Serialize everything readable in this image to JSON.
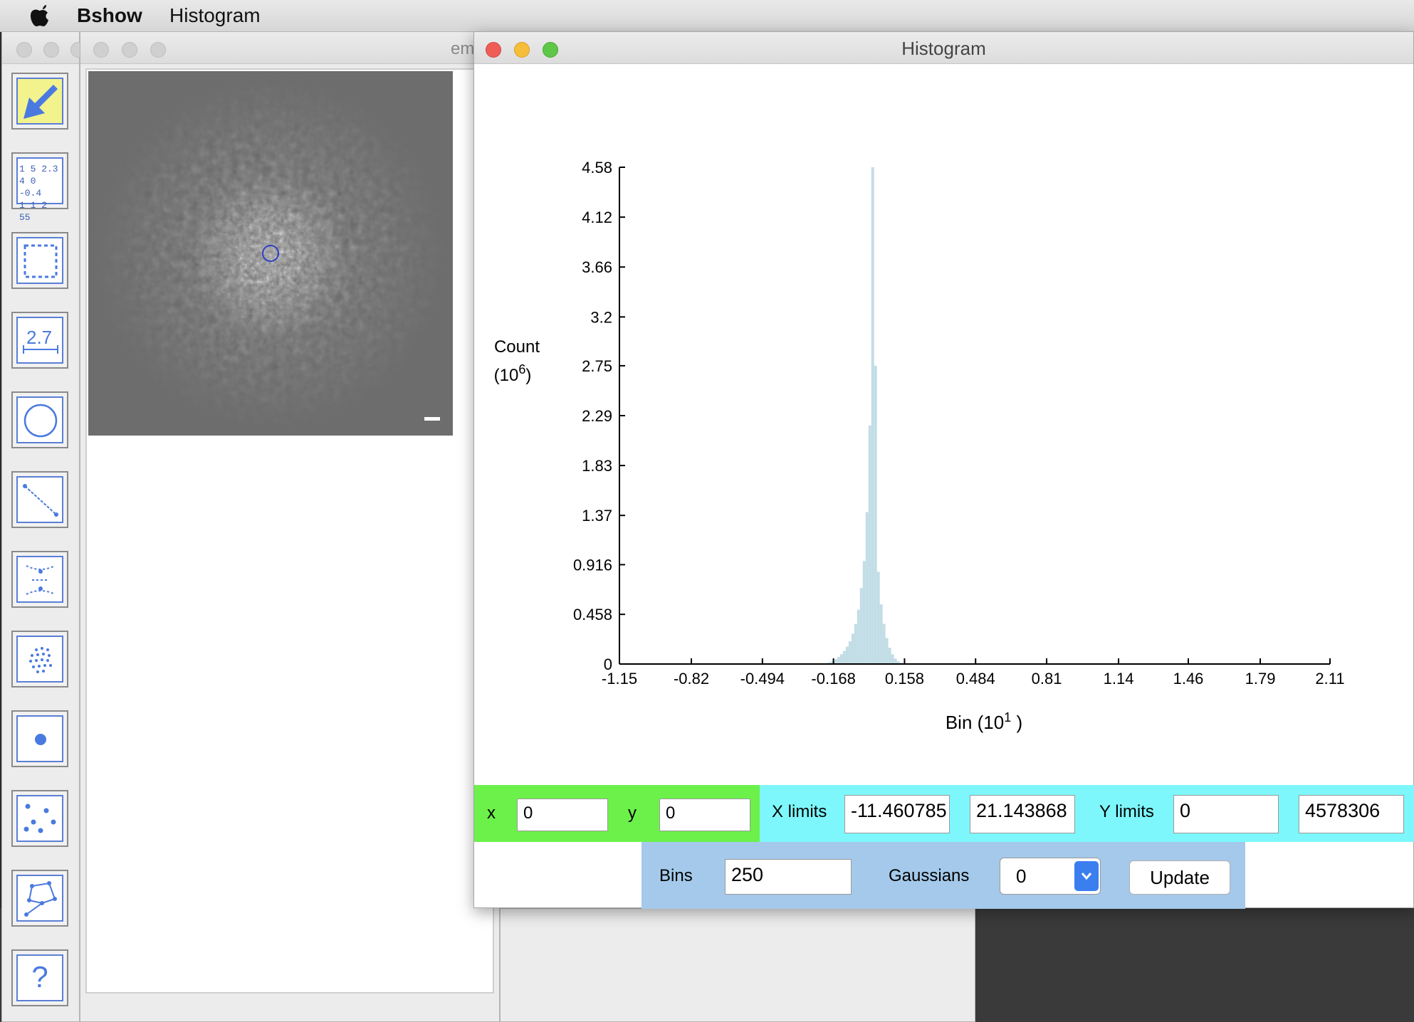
{
  "menubar": {
    "app": "Bshow",
    "menu": "Histogram"
  },
  "image_window": {
    "title_fragment": "em"
  },
  "tools": [
    {
      "name": "pointer-tool",
      "icon": "arrow-pointer-icon",
      "active": true
    },
    {
      "name": "values-tool",
      "icon": "number-grid-icon",
      "lines": [
        "1 5 2.3",
        "4 0 -0.4",
        "1 1 2 55"
      ]
    },
    {
      "name": "box-select-tool",
      "icon": "dashed-box-icon"
    },
    {
      "name": "measure-tool",
      "icon": "ruler-icon",
      "text": "2.7"
    },
    {
      "name": "circle-tool",
      "icon": "circle-icon"
    },
    {
      "name": "line-tool",
      "icon": "line-segment-icon"
    },
    {
      "name": "filament-tool",
      "icon": "filament-icon"
    },
    {
      "name": "lattice-tool",
      "icon": "dot-lattice-icon"
    },
    {
      "name": "point-tool",
      "icon": "dot-icon"
    },
    {
      "name": "points-tool",
      "icon": "scattered-points-icon"
    },
    {
      "name": "polygon-tool",
      "icon": "polygon-icon"
    },
    {
      "name": "help-tool",
      "icon": "question-icon",
      "text": "?"
    }
  ],
  "histogram_window": {
    "title": "Histogram",
    "chart_data": {
      "type": "bar",
      "ylabel": "Count",
      "ylabel_unit": "(10",
      "ylabel_exp": "6",
      "ylabel_close": ")",
      "xlabel": "Bin (10",
      "xlabel_exp": "1",
      "xlabel_close": " )",
      "xlim": [
        -1.146078,
        2.114387
      ],
      "ylim": [
        0,
        4.578306
      ],
      "yticks": [
        "0",
        "0.458",
        "0.916",
        "1.37",
        "1.83",
        "2.29",
        "2.75",
        "3.2",
        "3.66",
        "4.12",
        "4.58"
      ],
      "ytick_values": [
        0,
        0.458,
        0.916,
        1.37,
        1.83,
        2.29,
        2.75,
        3.2,
        3.66,
        4.12,
        4.58
      ],
      "xticks": [
        "-1.15",
        "-0.82",
        "-0.494",
        "-0.168",
        "0.158",
        "0.484",
        "0.81",
        "1.14",
        "1.46",
        "1.79",
        "2.11"
      ],
      "xtick_values": [
        -1.15,
        -0.82,
        -0.494,
        -0.168,
        0.158,
        0.484,
        0.81,
        1.14,
        1.46,
        1.79,
        2.11
      ],
      "bar_color": "#c2dde6",
      "bins": {
        "x": [
          -0.22,
          -0.209,
          -0.196,
          -0.183,
          -0.17,
          -0.157,
          -0.144,
          -0.131,
          -0.118,
          -0.105,
          -0.092,
          -0.079,
          -0.066,
          -0.053,
          -0.04,
          -0.027,
          -0.014,
          -0.001,
          0.012,
          0.025,
          0.038,
          0.051,
          0.064,
          0.077,
          0.09,
          0.103,
          0.116,
          0.129,
          0.142,
          0.155
        ],
        "y": [
          0.002,
          0.005,
          0.01,
          0.018,
          0.03,
          0.045,
          0.065,
          0.09,
          0.12,
          0.16,
          0.21,
          0.28,
          0.37,
          0.5,
          0.7,
          0.95,
          1.4,
          2.2,
          4.58,
          2.75,
          0.85,
          0.55,
          0.37,
          0.24,
          0.15,
          0.09,
          0.05,
          0.025,
          0.012,
          0.004
        ]
      }
    },
    "controls": {
      "x_label": "x",
      "x_value": "0",
      "y_label": "y",
      "y_value": "0",
      "xlimits_label": "X limits",
      "xlim_min": "-11.460785",
      "xlim_max": "21.143868",
      "ylimits_label": "Y limits",
      "ylim_min": "0",
      "ylim_max": "4578306",
      "bins_label": "Bins",
      "bins_value": "250",
      "gaussians_label": "Gaussians",
      "gaussians_value": "0",
      "update_label": "Update"
    },
    "colors": {
      "green_panel": "#6cf14a",
      "cyan_panel": "#7df7fb",
      "blue_panel": "#a4c9ea"
    }
  }
}
